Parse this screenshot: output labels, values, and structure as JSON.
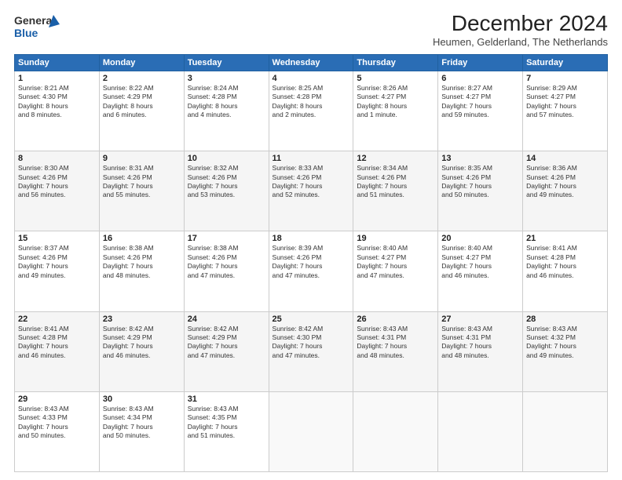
{
  "header": {
    "logo_line1": "General",
    "logo_line2": "Blue",
    "title": "December 2024",
    "subtitle": "Heumen, Gelderland, The Netherlands"
  },
  "columns": [
    "Sunday",
    "Monday",
    "Tuesday",
    "Wednesday",
    "Thursday",
    "Friday",
    "Saturday"
  ],
  "rows": [
    [
      {
        "day": "1",
        "text": "Sunrise: 8:21 AM\nSunset: 4:30 PM\nDaylight: 8 hours\nand 8 minutes."
      },
      {
        "day": "2",
        "text": "Sunrise: 8:22 AM\nSunset: 4:29 PM\nDaylight: 8 hours\nand 6 minutes."
      },
      {
        "day": "3",
        "text": "Sunrise: 8:24 AM\nSunset: 4:28 PM\nDaylight: 8 hours\nand 4 minutes."
      },
      {
        "day": "4",
        "text": "Sunrise: 8:25 AM\nSunset: 4:28 PM\nDaylight: 8 hours\nand 2 minutes."
      },
      {
        "day": "5",
        "text": "Sunrise: 8:26 AM\nSunset: 4:27 PM\nDaylight: 8 hours\nand 1 minute."
      },
      {
        "day": "6",
        "text": "Sunrise: 8:27 AM\nSunset: 4:27 PM\nDaylight: 7 hours\nand 59 minutes."
      },
      {
        "day": "7",
        "text": "Sunrise: 8:29 AM\nSunset: 4:27 PM\nDaylight: 7 hours\nand 57 minutes."
      }
    ],
    [
      {
        "day": "8",
        "text": "Sunrise: 8:30 AM\nSunset: 4:26 PM\nDaylight: 7 hours\nand 56 minutes."
      },
      {
        "day": "9",
        "text": "Sunrise: 8:31 AM\nSunset: 4:26 PM\nDaylight: 7 hours\nand 55 minutes."
      },
      {
        "day": "10",
        "text": "Sunrise: 8:32 AM\nSunset: 4:26 PM\nDaylight: 7 hours\nand 53 minutes."
      },
      {
        "day": "11",
        "text": "Sunrise: 8:33 AM\nSunset: 4:26 PM\nDaylight: 7 hours\nand 52 minutes."
      },
      {
        "day": "12",
        "text": "Sunrise: 8:34 AM\nSunset: 4:26 PM\nDaylight: 7 hours\nand 51 minutes."
      },
      {
        "day": "13",
        "text": "Sunrise: 8:35 AM\nSunset: 4:26 PM\nDaylight: 7 hours\nand 50 minutes."
      },
      {
        "day": "14",
        "text": "Sunrise: 8:36 AM\nSunset: 4:26 PM\nDaylight: 7 hours\nand 49 minutes."
      }
    ],
    [
      {
        "day": "15",
        "text": "Sunrise: 8:37 AM\nSunset: 4:26 PM\nDaylight: 7 hours\nand 49 minutes."
      },
      {
        "day": "16",
        "text": "Sunrise: 8:38 AM\nSunset: 4:26 PM\nDaylight: 7 hours\nand 48 minutes."
      },
      {
        "day": "17",
        "text": "Sunrise: 8:38 AM\nSunset: 4:26 PM\nDaylight: 7 hours\nand 47 minutes."
      },
      {
        "day": "18",
        "text": "Sunrise: 8:39 AM\nSunset: 4:26 PM\nDaylight: 7 hours\nand 47 minutes."
      },
      {
        "day": "19",
        "text": "Sunrise: 8:40 AM\nSunset: 4:27 PM\nDaylight: 7 hours\nand 47 minutes."
      },
      {
        "day": "20",
        "text": "Sunrise: 8:40 AM\nSunset: 4:27 PM\nDaylight: 7 hours\nand 46 minutes."
      },
      {
        "day": "21",
        "text": "Sunrise: 8:41 AM\nSunset: 4:28 PM\nDaylight: 7 hours\nand 46 minutes."
      }
    ],
    [
      {
        "day": "22",
        "text": "Sunrise: 8:41 AM\nSunset: 4:28 PM\nDaylight: 7 hours\nand 46 minutes."
      },
      {
        "day": "23",
        "text": "Sunrise: 8:42 AM\nSunset: 4:29 PM\nDaylight: 7 hours\nand 46 minutes."
      },
      {
        "day": "24",
        "text": "Sunrise: 8:42 AM\nSunset: 4:29 PM\nDaylight: 7 hours\nand 47 minutes."
      },
      {
        "day": "25",
        "text": "Sunrise: 8:42 AM\nSunset: 4:30 PM\nDaylight: 7 hours\nand 47 minutes."
      },
      {
        "day": "26",
        "text": "Sunrise: 8:43 AM\nSunset: 4:31 PM\nDaylight: 7 hours\nand 48 minutes."
      },
      {
        "day": "27",
        "text": "Sunrise: 8:43 AM\nSunset: 4:31 PM\nDaylight: 7 hours\nand 48 minutes."
      },
      {
        "day": "28",
        "text": "Sunrise: 8:43 AM\nSunset: 4:32 PM\nDaylight: 7 hours\nand 49 minutes."
      }
    ],
    [
      {
        "day": "29",
        "text": "Sunrise: 8:43 AM\nSunset: 4:33 PM\nDaylight: 7 hours\nand 50 minutes."
      },
      {
        "day": "30",
        "text": "Sunrise: 8:43 AM\nSunset: 4:34 PM\nDaylight: 7 hours\nand 50 minutes."
      },
      {
        "day": "31",
        "text": "Sunrise: 8:43 AM\nSunset: 4:35 PM\nDaylight: 7 hours\nand 51 minutes."
      },
      {
        "day": "",
        "text": ""
      },
      {
        "day": "",
        "text": ""
      },
      {
        "day": "",
        "text": ""
      },
      {
        "day": "",
        "text": ""
      }
    ]
  ]
}
